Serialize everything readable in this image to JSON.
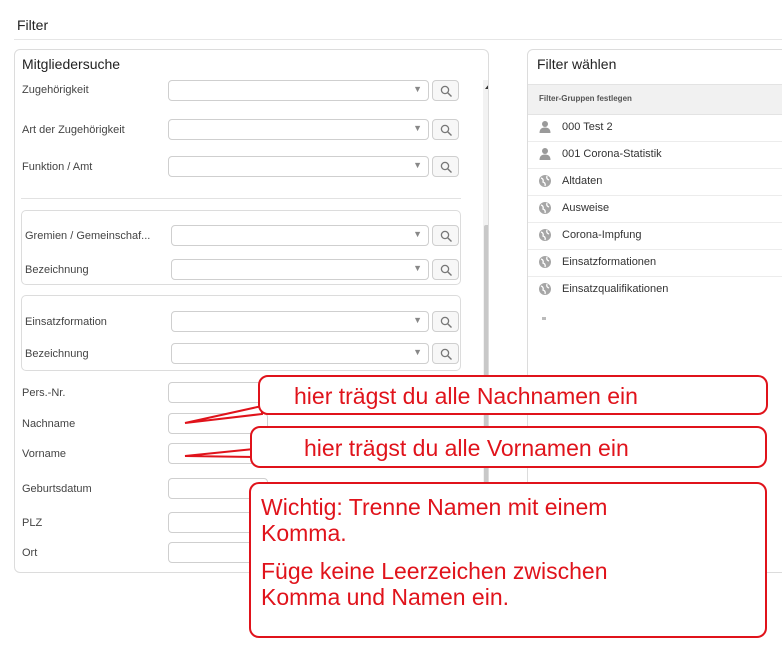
{
  "page": {
    "title": "Filter"
  },
  "member_search": {
    "title": "Mitgliedersuche",
    "rows": [
      {
        "label": "Zugehörigkeit"
      },
      {
        "label": "Art der Zugehörigkeit"
      },
      {
        "label": "Funktion / Amt"
      }
    ],
    "group1": [
      {
        "label": "Gremien / Gemeinschaf..."
      },
      {
        "label": "Bezeichnung"
      }
    ],
    "group2": [
      {
        "label": "Einsatzformation"
      },
      {
        "label": "Bezeichnung"
      }
    ],
    "fields": [
      {
        "label": "Pers.-Nr."
      },
      {
        "label": "Nachname"
      },
      {
        "label": "Vorname"
      },
      {
        "label": "Geburtsdatum"
      },
      {
        "label": "PLZ"
      },
      {
        "label": "Ort"
      }
    ]
  },
  "filter_select": {
    "title": "Filter wählen",
    "header": "Filter-Gruppen festlegen",
    "items": [
      {
        "label": "000 Test 2",
        "icon": "person-icon"
      },
      {
        "label": "001 Corona-Statistik",
        "icon": "person-icon"
      },
      {
        "label": "Altdaten",
        "icon": "globe-icon"
      },
      {
        "label": "Ausweise",
        "icon": "globe-icon"
      },
      {
        "label": "Corona-Impfung",
        "icon": "globe-icon"
      },
      {
        "label": "Einsatzformationen",
        "icon": "globe-icon"
      },
      {
        "label": "Einsatzqualifikationen",
        "icon": "globe-icon"
      }
    ]
  },
  "annotations": {
    "lastname_hint": "hier trägst du alle Nachnamen ein",
    "firstname_hint": "hier trägst du alle Vornamen ein",
    "note_lines": [
      "Wichtig: Trenne Namen mit einem",
      "Komma.",
      "Füge keine Leerzeichen zwischen",
      "Komma und Namen ein."
    ],
    "color": "#e0131b"
  }
}
